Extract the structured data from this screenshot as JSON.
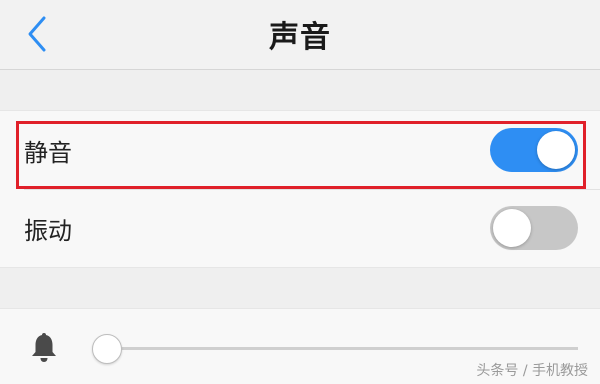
{
  "header": {
    "title": "声音"
  },
  "settings": {
    "mute": {
      "label": "静音",
      "enabled": true
    },
    "vibrate": {
      "label": "振动",
      "enabled": false
    }
  },
  "volume": {
    "level": 0.0
  },
  "watermark": "头条号 / 手机教授",
  "colors": {
    "toggle_on": "#2e8ef3",
    "toggle_off": "#c7c7c7",
    "back_icon": "#2e8ef3",
    "highlight": "#e0202a"
  },
  "icons": {
    "back": "chevron-left-icon",
    "volume": "bell-icon"
  }
}
